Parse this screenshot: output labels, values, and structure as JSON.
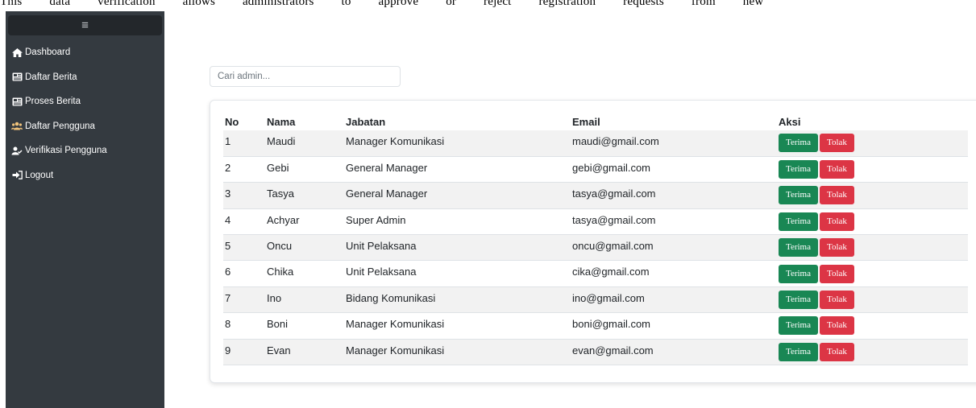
{
  "caption": "This data verification allows administrators to approve or reject registration requests from new",
  "colors": {
    "sidebar_bg": "#343a40",
    "accept": "#198754",
    "reject": "#dc3545",
    "row_stripe": "#f2f2f2"
  },
  "sidebar": {
    "toggle_icon": "menu-icon",
    "toggle_label": "≡",
    "items": [
      {
        "label": "Dashboard",
        "icon": "home-icon"
      },
      {
        "label": "Daftar Berita",
        "icon": "newspaper-icon"
      },
      {
        "label": "Proses Berita",
        "icon": "newspaper-icon"
      },
      {
        "label": "Daftar Pengguna",
        "icon": "users-icon"
      },
      {
        "label": "Verifikasi Pengguna",
        "icon": "user-check-icon"
      },
      {
        "label": "Logout",
        "icon": "sign-out-icon"
      }
    ]
  },
  "search": {
    "placeholder": "Cari admin...",
    "value": ""
  },
  "table": {
    "headers": [
      "No",
      "Nama",
      "Jabatan",
      "Email",
      "Aksi"
    ],
    "accept_label": "Terima",
    "reject_label": "Tolak",
    "rows": [
      {
        "no": "1",
        "nama": "Maudi",
        "jabatan": "Manager Komunikasi",
        "email": "maudi@gmail.com"
      },
      {
        "no": "2",
        "nama": "Gebi",
        "jabatan": "General Manager",
        "email": "gebi@gmail.com"
      },
      {
        "no": "3",
        "nama": "Tasya",
        "jabatan": "General Manager",
        "email": "tasya@gmail.com"
      },
      {
        "no": "4",
        "nama": "Achyar",
        "jabatan": "Super Admin",
        "email": "tasya@gmail.com"
      },
      {
        "no": "5",
        "nama": "Oncu",
        "jabatan": "Unit Pelaksana",
        "email": "oncu@gmail.com"
      },
      {
        "no": "6",
        "nama": "Chika",
        "jabatan": "Unit Pelaksana",
        "email": "cika@gmail.com"
      },
      {
        "no": "7",
        "nama": "Ino",
        "jabatan": "Bidang Komunikasi",
        "email": "ino@gmail.com"
      },
      {
        "no": "8",
        "nama": "Boni",
        "jabatan": "Manager Komunikasi",
        "email": "boni@gmail.com"
      },
      {
        "no": "9",
        "nama": "Evan",
        "jabatan": "Manager Komunikasi",
        "email": "evan@gmail.com"
      }
    ]
  }
}
